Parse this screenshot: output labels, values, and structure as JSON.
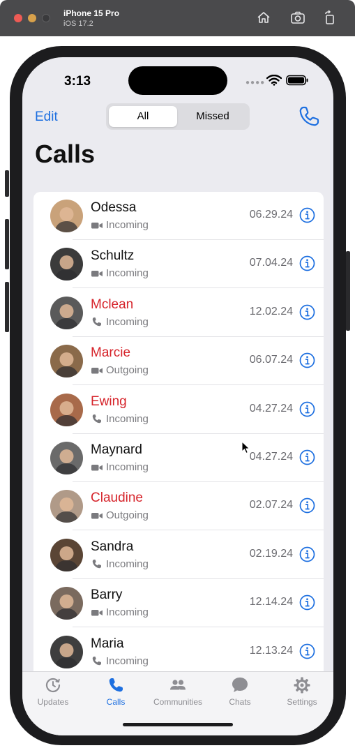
{
  "simulator": {
    "device_name": "iPhone 15 Pro",
    "os_version": "iOS 17.2"
  },
  "status_bar": {
    "time": "3:13"
  },
  "nav": {
    "edit_label": "Edit",
    "segments": [
      "All",
      "Missed"
    ],
    "selected_segment": "All",
    "title": "Calls"
  },
  "calls": [
    {
      "name": "Odessa",
      "type": "video",
      "direction": "Incoming",
      "date": "06.29.24",
      "missed": false,
      "avatar_color": "#c9a27a"
    },
    {
      "name": "Schultz",
      "type": "video",
      "direction": "Incoming",
      "date": "07.04.24",
      "missed": false,
      "avatar_color": "#3b3b3b"
    },
    {
      "name": "Mclean",
      "type": "phone",
      "direction": "Incoming",
      "date": "12.02.24",
      "missed": true,
      "avatar_color": "#5a5a5a"
    },
    {
      "name": "Marcie",
      "type": "video",
      "direction": "Outgoing",
      "date": "06.07.24",
      "missed": true,
      "avatar_color": "#8a6a4a"
    },
    {
      "name": "Ewing",
      "type": "phone",
      "direction": "Incoming",
      "date": "04.27.24",
      "missed": true,
      "avatar_color": "#a86a4a"
    },
    {
      "name": "Maynard",
      "type": "video",
      "direction": "Incoming",
      "date": "04.27.24",
      "missed": false,
      "avatar_color": "#6a6a6a"
    },
    {
      "name": "Claudine",
      "type": "video",
      "direction": "Outgoing",
      "date": "02.07.24",
      "missed": true,
      "avatar_color": "#b09a88"
    },
    {
      "name": "Sandra",
      "type": "phone",
      "direction": "Incoming",
      "date": "02.19.24",
      "missed": false,
      "avatar_color": "#5a4535"
    },
    {
      "name": "Barry",
      "type": "video",
      "direction": "Incoming",
      "date": "12.14.24",
      "missed": false,
      "avatar_color": "#7a6a5e"
    },
    {
      "name": "Maria",
      "type": "phone",
      "direction": "Incoming",
      "date": "12.13.24",
      "missed": false,
      "avatar_color": "#3e3e3e"
    }
  ],
  "tabbar": {
    "tabs": [
      {
        "label": "Updates",
        "icon": "updates-icon"
      },
      {
        "label": "Calls",
        "icon": "phone-icon"
      },
      {
        "label": "Communities",
        "icon": "communities-icon"
      },
      {
        "label": "Chats",
        "icon": "chats-icon"
      },
      {
        "label": "Settings",
        "icon": "gear-icon"
      }
    ],
    "active": "Calls"
  },
  "colors": {
    "accent": "#1d6fe0",
    "missed": "#d6242b",
    "secondary_text": "#7a7a7e",
    "background": "#ebebf0"
  }
}
